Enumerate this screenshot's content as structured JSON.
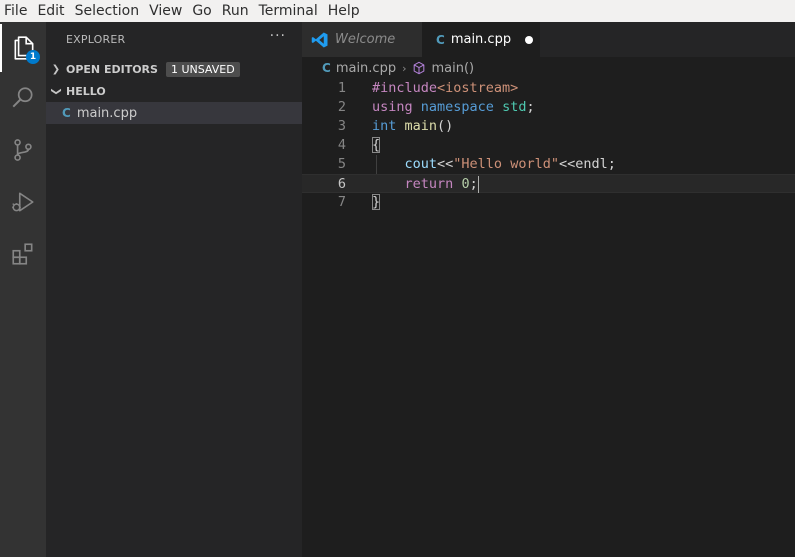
{
  "menubar": [
    "File",
    "Edit",
    "Selection",
    "View",
    "Go",
    "Run",
    "Terminal",
    "Help"
  ],
  "activity": {
    "explorer_badge": "1"
  },
  "sidebar": {
    "title": "EXPLORER",
    "more": "···",
    "open_editors": {
      "label": "OPEN EDITORS",
      "badge": "1 UNSAVED"
    },
    "folder": {
      "label": "HELLO"
    },
    "file": {
      "label": "main.cpp",
      "icon": "C"
    }
  },
  "tabs": [
    {
      "label": "Welcome"
    },
    {
      "label": "main.cpp",
      "icon": "C"
    }
  ],
  "breadcrumb": {
    "file": "main.cpp",
    "symbol": "main()",
    "sep": "›"
  },
  "editor": {
    "line_numbers": [
      "1",
      "2",
      "3",
      "4",
      "5",
      "6",
      "7"
    ],
    "l1": {
      "pp": "#include",
      "header": "<iostream>"
    },
    "l2": {
      "kw1": "using",
      "kw2": "namespace",
      "ns": "std",
      "semi": ";"
    },
    "l3": {
      "ty": "int",
      "fn": "main",
      "paren": "()"
    },
    "l4": {
      "brace": "{"
    },
    "l5": {
      "indent": "    ",
      "var": "cout",
      "op1": "<<",
      "str": "\"Hello world\"",
      "op2": "<<",
      "var2": "endl",
      "semi": ";"
    },
    "l6": {
      "indent": "    ",
      "kw": "return",
      "num": "0",
      "semi": ";"
    },
    "l7": {
      "brace": "}"
    }
  },
  "colors": {
    "accent": "#007acc",
    "editor_bg": "#1e1e1e",
    "sidebar_bg": "#252526",
    "activity_bg": "#333333"
  }
}
